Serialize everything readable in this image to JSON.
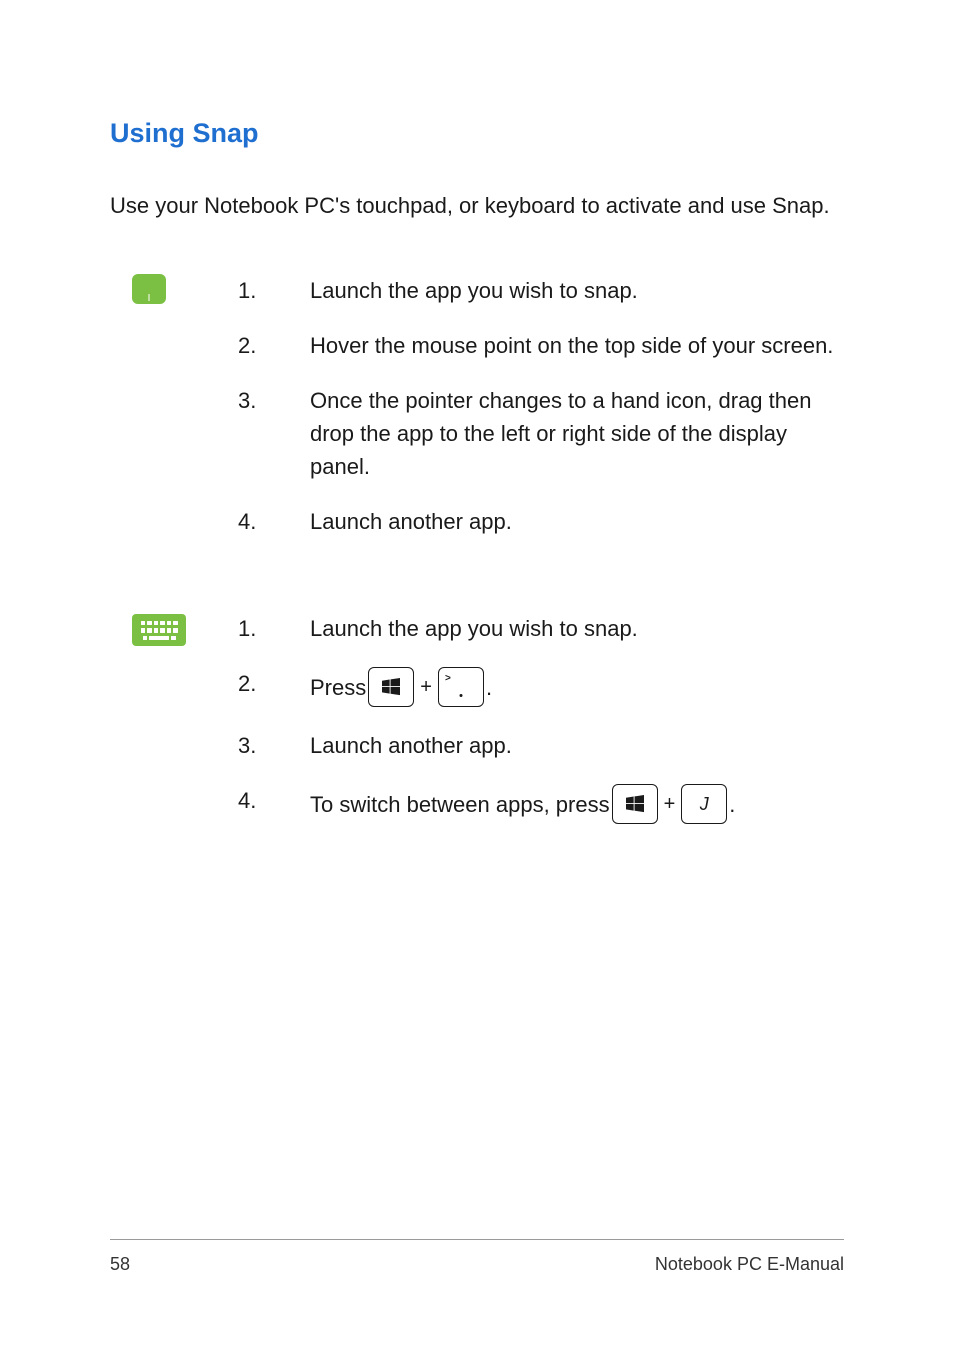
{
  "heading": "Using Snap",
  "intro": "Use your Notebook PC's touchpad, or keyboard to activate and use Snap.",
  "touchpad": {
    "steps": [
      {
        "n": "1.",
        "t": "Launch the app you wish to snap."
      },
      {
        "n": "2.",
        "t": "Hover the mouse point on the top side of your screen."
      },
      {
        "n": "3.",
        "t": "Once the pointer changes to a hand icon, drag then drop the app to the left or right side of the display panel."
      },
      {
        "n": "4.",
        "t": "Launch another app."
      }
    ]
  },
  "keyboard": {
    "steps": [
      {
        "n": "1.",
        "t": "Launch the app you wish to snap."
      },
      {
        "n": "2.",
        "t_before": "Press ",
        "t_plus": "+",
        "t_after": "."
      },
      {
        "n": "3.",
        "t": "Launch another app."
      },
      {
        "n": "4.",
        "t_before": "To switch between apps, press ",
        "t_plus": "+",
        "key2": "J",
        "t_after": "."
      }
    ],
    "period_key_gt": ">"
  },
  "footer": {
    "page": "58",
    "title": "Notebook PC E-Manual"
  }
}
